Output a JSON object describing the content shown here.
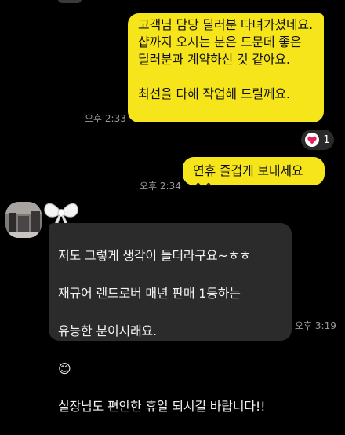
{
  "messages": {
    "outgoing_1": {
      "text": "고객님 담당 딜러분 다녀가셨네요.\n샵까지 오시는 분은 드문데 좋은\n딜러분과 계약하신 것 같아요.\n\n최선을 다해 작업해 드릴께요.",
      "time": "오후 2:33"
    },
    "reaction": {
      "count": "1",
      "icon": "heart-icon"
    },
    "outgoing_2": {
      "text": "연휴 즐겁게 보내세요^^",
      "time": "오후 2:34"
    },
    "incoming_1": {
      "line1": "저도 그렇게 생각이 들더라구요~ㅎㅎ",
      "line2": "재규어 랜드로버 매년 판매 1등하는",
      "line3": "유능한 분이시래요.",
      "emoji": "😊",
      "line5": "실장님도 편안한 휴일 되시길 바랍니다!!",
      "time": "오후 3:19"
    }
  },
  "colors": {
    "background": "#000000",
    "outgoing_bubble": "#f7e51b",
    "incoming_bubble": "#2b2b2b",
    "reaction_heart": "#e0245e"
  }
}
